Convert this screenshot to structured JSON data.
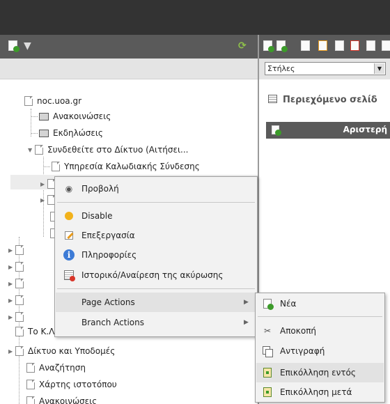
{
  "tree": {
    "root": "noc.uoa.gr",
    "items": [
      "Ανακοινώσεις",
      "Εκδηλώσεις",
      "Συνδεθείτε στο Δίκτυο (Αιτήσει...",
      "Υπηρεσία Καλωδιακής Σύνδεσης",
      "Το Κ.Λ.Ε.Π.Δ.Π.",
      "Δίκτυο και Υποδομές",
      "Αναζήτηση",
      "Χάρτης ιστοτόπου",
      "Ανακοινώσεις"
    ]
  },
  "right": {
    "select_value": "Στήλες",
    "content_title": "Περιεχόμενο σελίδ",
    "column_header": "Αριστερή"
  },
  "context_menu": {
    "items": [
      {
        "label": "Προβολή",
        "icon": "view-icon"
      },
      {
        "label": "Disable",
        "icon": "bulb-icon"
      },
      {
        "label": "Επεξεργασία",
        "icon": "edit-icon"
      },
      {
        "label": "Πληροφορίες",
        "icon": "info-icon"
      },
      {
        "label": "Ιστορικό/Αναίρεση της ακύρωσης",
        "icon": "history-icon"
      },
      {
        "label": "Page Actions"
      },
      {
        "label": "Branch Actions"
      }
    ]
  },
  "submenu": {
    "items": [
      {
        "label": "Νέα",
        "icon": "new-page-icon"
      },
      {
        "label": "Αποκοπή",
        "icon": "cut-icon"
      },
      {
        "label": "Αντιγραφή",
        "icon": "copy-icon"
      },
      {
        "label": "Επικόλληση εντός",
        "icon": "paste-into-icon"
      },
      {
        "label": "Επικόλληση μετά",
        "icon": "paste-after-icon"
      }
    ]
  },
  "colors": {
    "topbar": "#333333",
    "toolbar": "#5a5a5a",
    "menu_bg": "#f2f2f2",
    "menu_highlight": "#e2e2e2"
  }
}
